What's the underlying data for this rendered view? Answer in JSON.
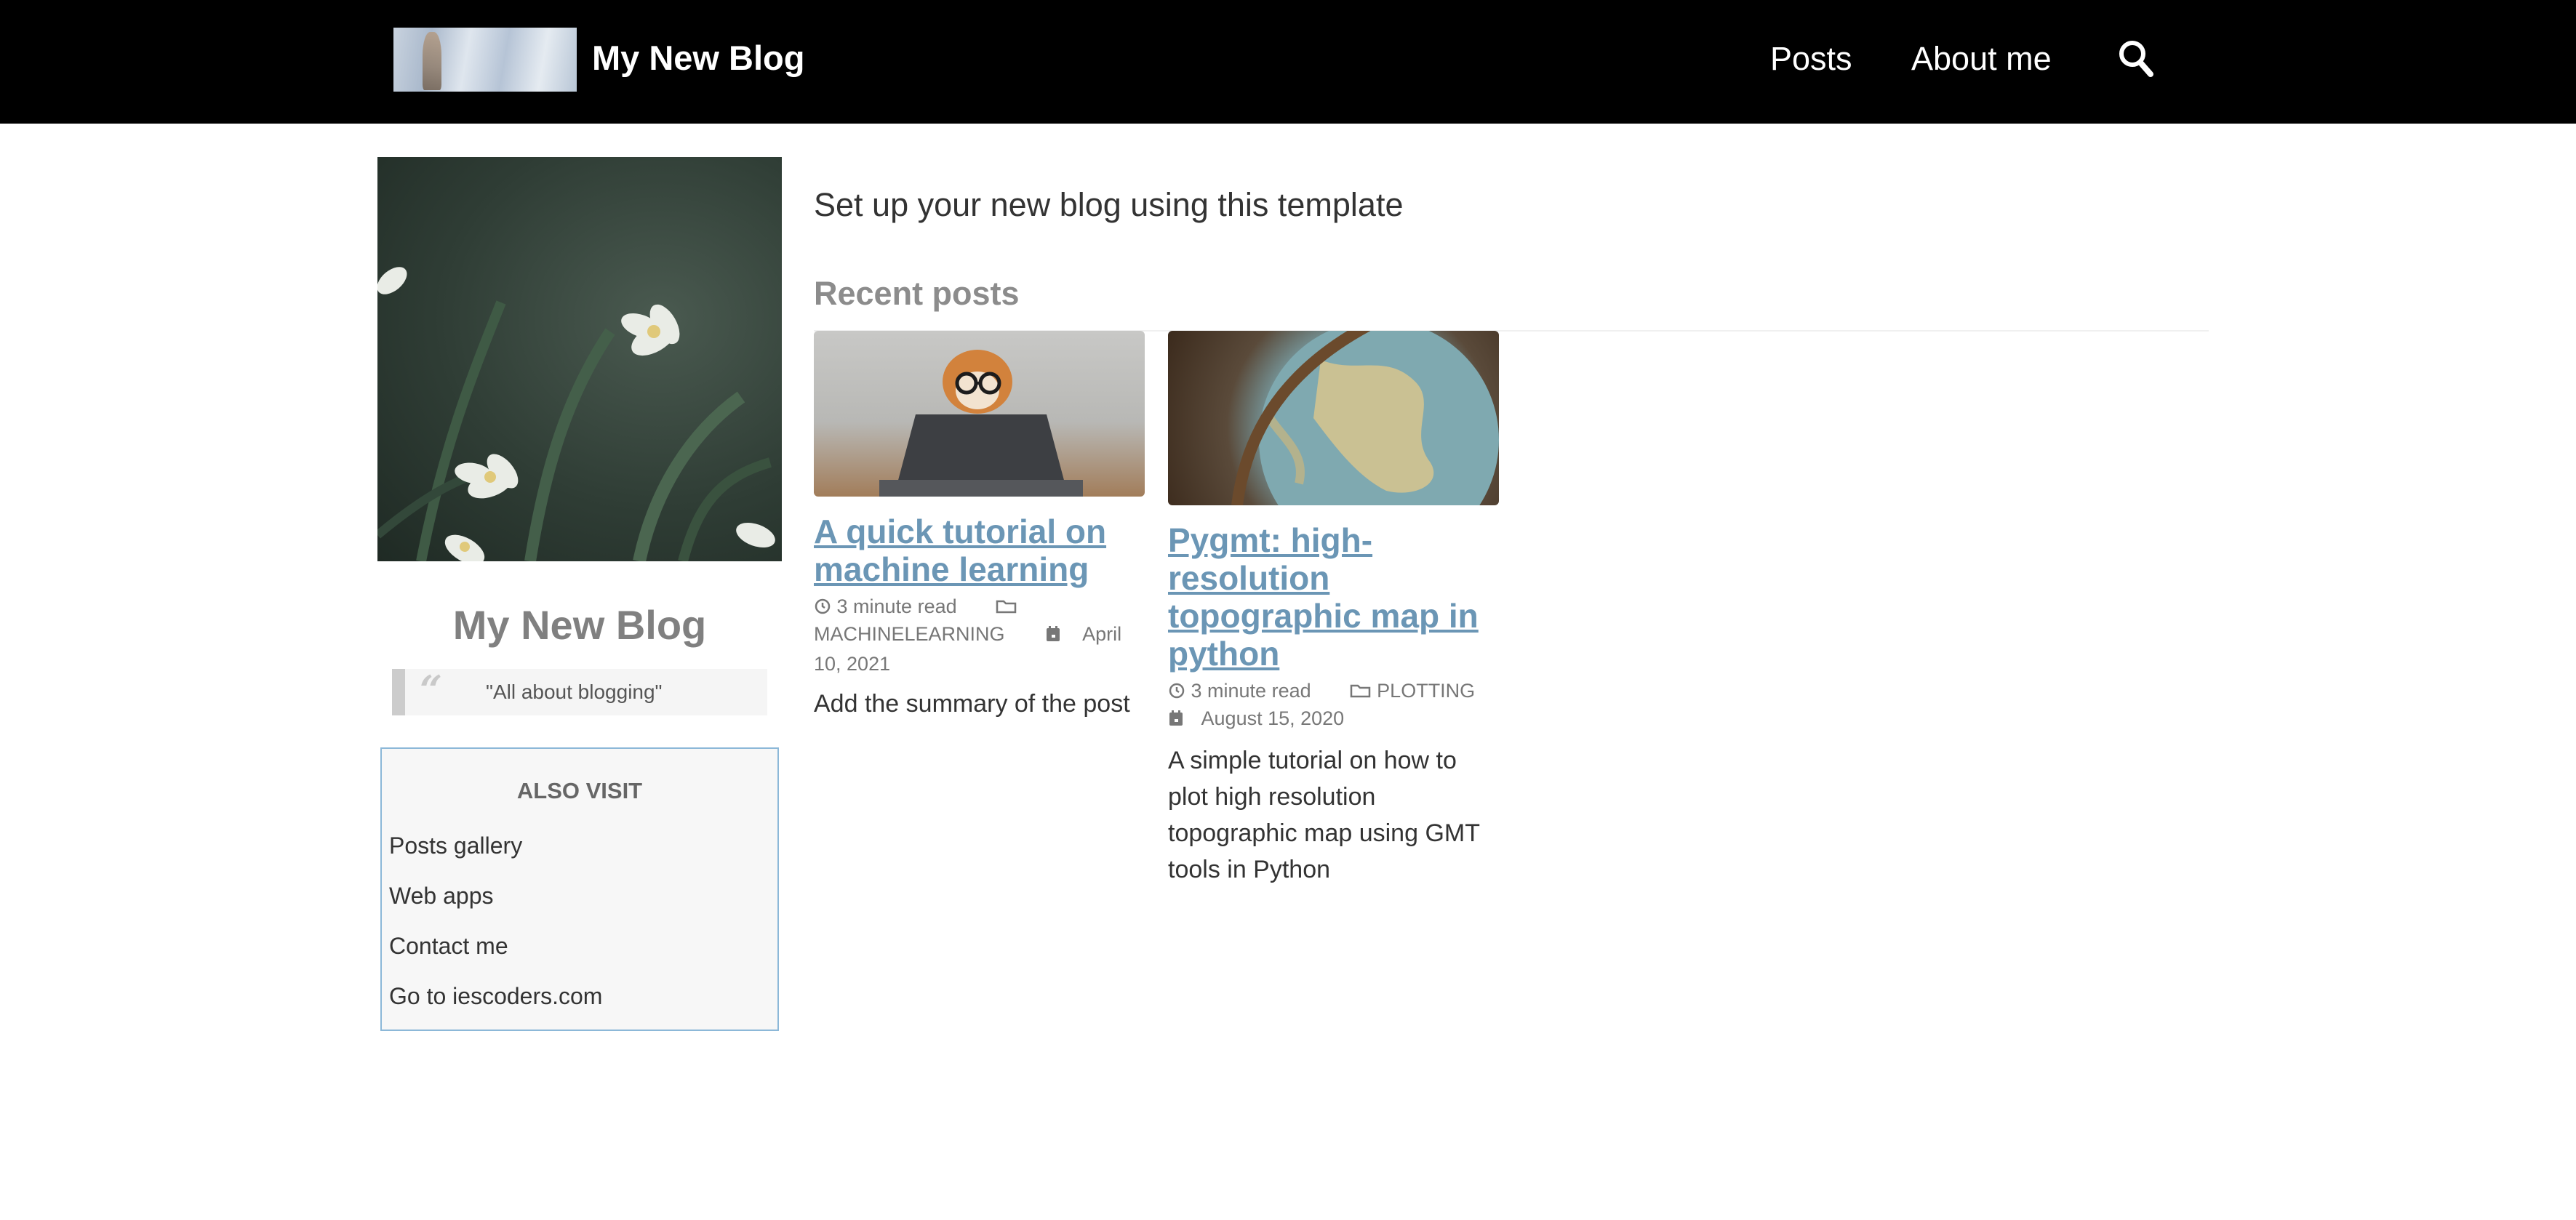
{
  "navbar": {
    "brand_title": "My New Blog",
    "links": [
      "Posts",
      "About me"
    ],
    "search_icon": "search-icon",
    "background": "#000000"
  },
  "sidebar": {
    "title": "My New Blog",
    "quote": "\"All about blogging\"",
    "also_visit": {
      "heading": "ALSO VISIT",
      "links": [
        "Posts gallery",
        "Web apps",
        "Contact me",
        "Go to iescoders.com"
      ]
    }
  },
  "main": {
    "tagline": "Set up your new blog using this template",
    "recent_heading": "Recent posts",
    "posts": [
      {
        "title": "A quick tutorial on machine learning",
        "read_time": "3 minute read",
        "category": "MACHINELEARNING",
        "date": "April 10, 2021",
        "summary": "Add the summary of the post"
      },
      {
        "title": "Pygmt: high-resolution topographic map in python",
        "read_time": "3 minute read",
        "category": "PLOTTING",
        "date": "August 15, 2020",
        "summary": "A simple tutorial on how to plot high resolution topographic map using GMT tools in Python"
      }
    ]
  },
  "colors": {
    "link": "#6b96b5",
    "sidebar_border": "#8cb8d8",
    "muted": "#8c8c8c"
  }
}
